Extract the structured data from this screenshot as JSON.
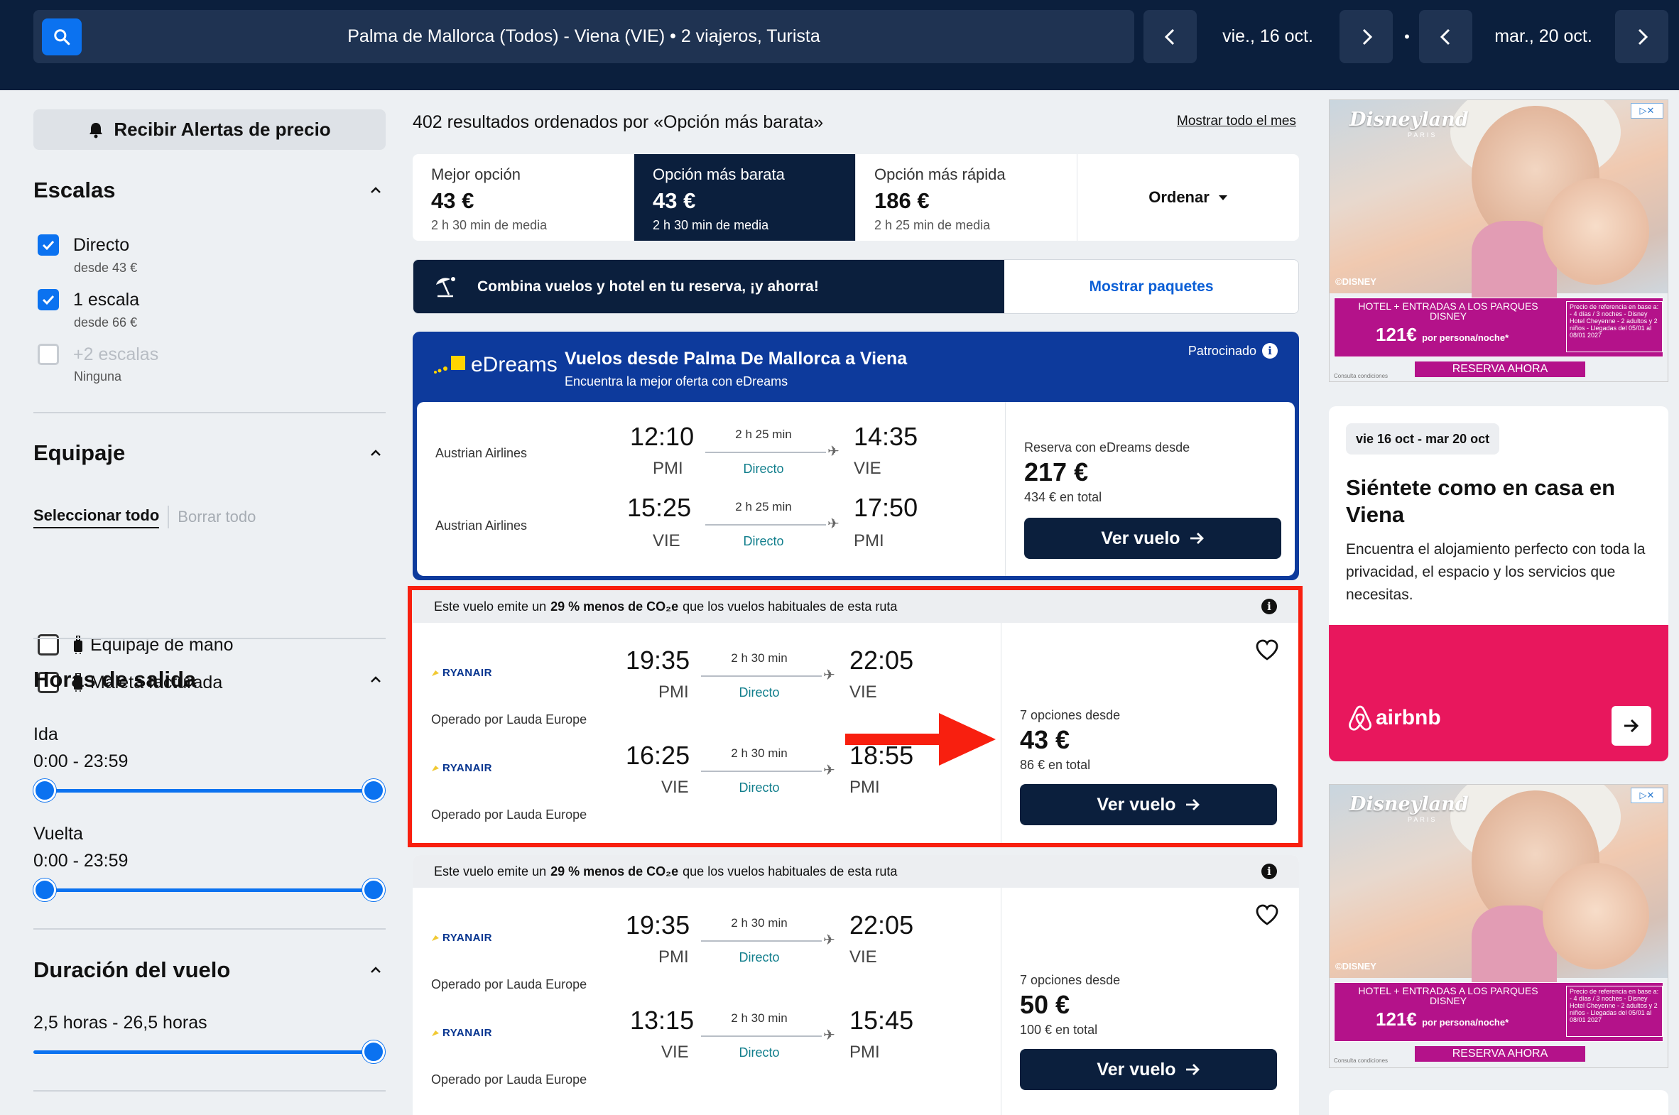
{
  "topbar": {
    "search_summary": "Palma de Mallorca (Todos) - Viena (VIE)  •  2 viajeros, Turista",
    "depart_date": "vie., 16 oct.",
    "return_date": "mar., 20 oct.",
    "dot": "•"
  },
  "sidebar": {
    "alert_button": "Recibir Alertas de precio",
    "stops": {
      "title": "Escalas",
      "items": [
        {
          "label": "Directo",
          "note": "desde 43 €",
          "checked": true
        },
        {
          "label": "1 escala",
          "note": "desde 66 €",
          "checked": true
        },
        {
          "label": "+2 escalas",
          "note": "Ninguna",
          "checked": false
        }
      ]
    },
    "baggage": {
      "title": "Equipaje",
      "select_all": "Seleccionar todo",
      "clear_all": "Borrar todo",
      "items": [
        {
          "label": "Equipaje de mano"
        },
        {
          "label": "Maleta facturada"
        }
      ]
    },
    "departure_times": {
      "title": "Horas de salida",
      "outbound_label": "Ida",
      "outbound_range": "0:00 - 23:59",
      "return_label": "Vuelta",
      "return_range": "0:00 - 23:59"
    },
    "duration": {
      "title": "Duración del vuelo",
      "range": "2,5 horas - 26,5 horas"
    }
  },
  "results": {
    "count_text": "402 resultados ordenados por «Opción más barata»",
    "month_link": "Mostrar todo el mes",
    "sort_tabs": [
      {
        "label": "Mejor opción",
        "price": "43 €",
        "avg": "2 h 30 min de media"
      },
      {
        "label": "Opción más barata",
        "price": "43 €",
        "avg": "2 h 30 min de media"
      },
      {
        "label": "Opción más rápida",
        "price": "186 €",
        "avg": "2 h 25 min de media"
      }
    ],
    "order_label": "Ordenar",
    "promo": {
      "text": "Combina vuelos y hotel en tu reserva, ¡y ahorra!",
      "button": "Mostrar paquetes"
    }
  },
  "sponsored": {
    "logo": "eDreams",
    "title": "Vuelos desde Palma De Mallorca a Viena",
    "subtitle": "Encuentra la mejor oferta con eDreams",
    "tag": "Patrocinado",
    "outbound": {
      "airline": "Austrian Airlines",
      "dep_time": "12:10",
      "dep_code": "PMI",
      "duration": "2 h 25 min",
      "stops": "Directo",
      "arr_time": "14:35",
      "arr_code": "VIE"
    },
    "inbound": {
      "airline": "Austrian Airlines",
      "dep_time": "15:25",
      "dep_code": "VIE",
      "duration": "2 h 25 min",
      "stops": "Directo",
      "arr_time": "17:50",
      "arr_code": "PMI"
    },
    "price_label": "Reserva con eDreams desde",
    "price": "217 €",
    "total": "434 € en total",
    "button": "Ver vuelo"
  },
  "flights": [
    {
      "co2_pre": "Este vuelo emite un ",
      "co2_bold": "29 % menos de CO₂e",
      "co2_post": " que los vuelos habituales de esta ruta",
      "outbound": {
        "airline": "RYANAIR",
        "operated": "Operado por Lauda Europe",
        "dep_time": "19:35",
        "dep_code": "PMI",
        "duration": "2 h 30 min",
        "stops": "Directo",
        "arr_time": "22:05",
        "arr_code": "VIE"
      },
      "inbound": {
        "airline": "RYANAIR",
        "operated": "Operado por Lauda Europe",
        "dep_time": "16:25",
        "dep_code": "VIE",
        "duration": "2 h 30 min",
        "stops": "Directo",
        "arr_time": "18:55",
        "arr_code": "PMI"
      },
      "options": "7 opciones desde",
      "price": "43 €",
      "total": "86 € en total",
      "button": "Ver vuelo"
    },
    {
      "co2_pre": "Este vuelo emite un ",
      "co2_bold": "29 % menos de CO₂e",
      "co2_post": " que los vuelos habituales de esta ruta",
      "outbound": {
        "airline": "RYANAIR",
        "operated": "Operado por Lauda Europe",
        "dep_time": "19:35",
        "dep_code": "PMI",
        "duration": "2 h 30 min",
        "stops": "Directo",
        "arr_time": "22:05",
        "arr_code": "VIE"
      },
      "inbound": {
        "airline": "RYANAIR",
        "operated": "Operado por Lauda Europe",
        "dep_time": "13:15",
        "dep_code": "VIE",
        "duration": "2 h 30 min",
        "stops": "Directo",
        "arr_time": "15:45",
        "arr_code": "PMI"
      },
      "options": "7 opciones desde",
      "price": "50 €",
      "total": "100 € en total",
      "button": "Ver vuelo"
    }
  ],
  "ads": {
    "disney": {
      "brand": "Disneyland",
      "brand_sub": "PARIS",
      "copyright": "©DISNEY",
      "headline": "HOTEL + ENTRADAS A LOS PARQUES DISNEY",
      "price": "121€",
      "price_note": "por persona/noche*",
      "fine_print": "Precio de referencia en base a: - 4 días / 3 noches - Disney Hotel Cheyenne - 2 adultos y 2 niños - Llegadas del 05/01 al 08/01 2027",
      "cta": "RESERVA AHORA",
      "conditions": "Consulta condiciones"
    },
    "airbnb": {
      "dates": "vie 16 oct - mar 20 oct",
      "title": "Siéntete como en casa en Viena",
      "text": "Encuentra el alojamiento perfecto con toda la privacidad, el espacio y los servicios que necesitas.",
      "logo": "airbnb"
    }
  },
  "colors": {
    "navy": "#0b1f3d",
    "blue": "#0b72f0",
    "edreams_blue": "#0d3a9c",
    "highlight_red": "#f81f0f",
    "airbnb_pink": "#e8175d",
    "disney_magenta": "#b4128a"
  }
}
